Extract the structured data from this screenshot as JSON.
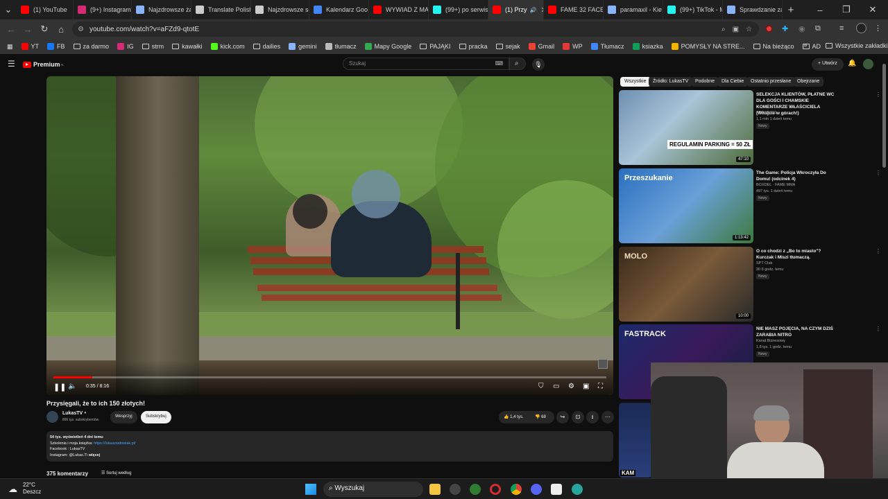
{
  "browser": {
    "tabs": [
      {
        "label": "(1) YouTube",
        "color": "#ff0000"
      },
      {
        "label": "(9+) Instagram",
        "color": "#d62976"
      },
      {
        "label": "Najzdrowsze ża",
        "color": "#8ab4f8"
      },
      {
        "label": "Translate Polish",
        "color": "#cccccc"
      },
      {
        "label": "Najzdrowsze sł",
        "color": "#cccccc"
      },
      {
        "label": "Kalendarz Goo",
        "color": "#4285f4"
      },
      {
        "label": "WYWIAD Z MA",
        "color": "#ff0000"
      },
      {
        "label": "(99+) po serwis",
        "color": "#25f4ee"
      },
      {
        "label": "(1) Przy",
        "color": "#ff0000"
      },
      {
        "label": "FAME 32 FACE",
        "color": "#ff0000"
      },
      {
        "label": "paramaxil - Kie",
        "color": "#8ab4f8"
      },
      {
        "label": "(99+) TikTok - M",
        "color": "#25f4ee"
      },
      {
        "label": "Sprawdzanie za",
        "color": "#8ab4f8"
      }
    ],
    "new_tab": "+",
    "url": "youtube.com/watch?v=aFZd9-qtotE",
    "bookmarks": [
      "YT",
      "FB",
      "za darmo",
      "IG",
      "strm",
      "kawałki",
      "kick.com",
      "dailies",
      "gemini",
      "tłumacz",
      "Mapy Google",
      "PAJĄKI",
      "pracka",
      "sejak",
      "Gmail",
      "WP",
      "Tłumacz",
      "ksiazka",
      "POMYSŁY NA STRE...",
      "Na bieżąco",
      "AD"
    ],
    "all_bookmarks": "Wszystkie zakładki",
    "more_bookmarks": "»"
  },
  "youtube": {
    "logo": "Premium",
    "logo_sup": "PL",
    "search_placeholder": "Szukaj",
    "create_label": "Utwórz",
    "video": {
      "time": "0:35 / 8:16",
      "progress": 0.07,
      "title": "Przysięgali, że to ich 150 złotych!",
      "channel": "LukasTV",
      "subs": "896 tys. subskrybentów",
      "support": "Wesprzyj",
      "subscribe": "Subskrybuj",
      "likes": "1,4 tys.",
      "dislikes": "68",
      "views_line": "54 tys. wyświetleń  4 dni temu",
      "desc_line1_text": "Szkolenia i moja książka: ",
      "desc_line1_link": "https://lukaszwdowiak.pl/",
      "desc_line2": "Facebook : LukasTV",
      "desc_line3": "Instagram: @Lukas.T\\",
      "more": "więcej",
      "comments_count": "375 komentarzy",
      "sort_label": "Sortuj według"
    },
    "chips": [
      "Wszystkie",
      "Źródło: LukasTV",
      "Podobne",
      "Dla Ciebie",
      "Ostatnio przesłane",
      "Obejrzane"
    ],
    "recommendations": [
      {
        "title": "SELEKCJA KLIENTÓW, PŁATNE WC DLA GOŚCI I CHAMSKIE KOMENTARZE WŁAŚCICIELA (Witojcie w górach!)",
        "channel": "KRAJZUSO",
        "meta": "1,1 mln  1 dzień temu",
        "badge": "Nowy",
        "duration": "47:10",
        "thumb_text": "REGULAMIN PARKING = 50 ZŁ"
      },
      {
        "title": "The Game: Policja Wkroczyła Do Domu! (odcinek 4)",
        "channel": "BOXDEL · FAME MMA",
        "meta": "497 tys.  1 dzień temu",
        "badge": "Nowy",
        "duration": "1:13:42",
        "thumb_text": "Przeszukanie"
      },
      {
        "title": "O co chodzi z „Bo to miasto\"? Kurczak i Miszi tłumaczą.",
        "channel": "SPT Club",
        "meta": "30  6 godz. temu",
        "badge": "Nowy",
        "duration": "10:00",
        "thumb_text": "MOLO"
      },
      {
        "title": "NIE MASZ POJĘCIA, NA CZYM DZIŚ ZARABIA NITRO",
        "channel": "Kanał Biznesowy",
        "meta": "1,8 tys.  1 godz. temu",
        "badge": "Nowy",
        "duration": "",
        "thumb_text": "FASTRACK"
      }
    ],
    "partial_thumb_text": "KAM"
  },
  "taskbar": {
    "weather_temp": "22°C",
    "weather_desc": "Deszcz",
    "search_label": "Wyszukaj"
  }
}
